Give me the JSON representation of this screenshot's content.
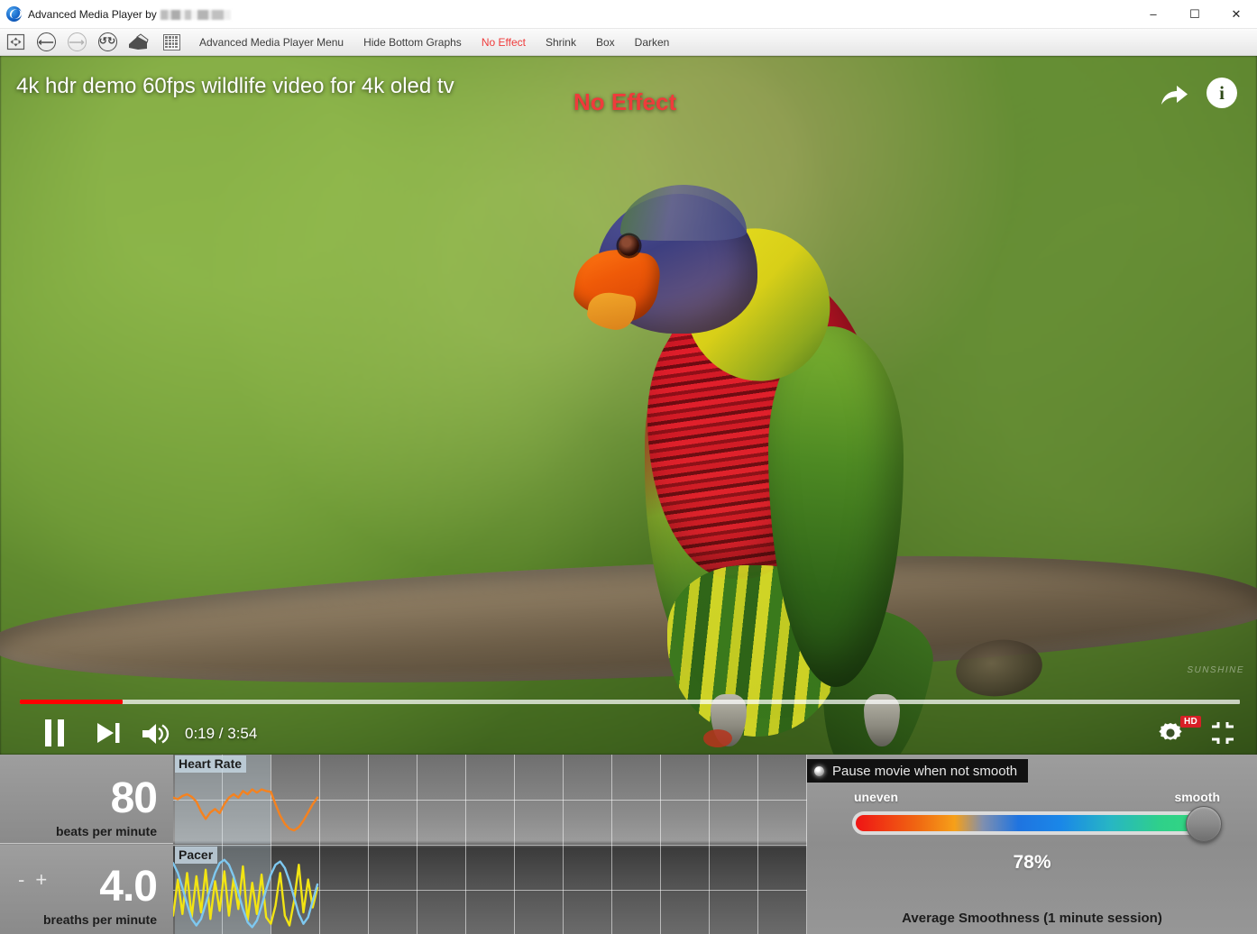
{
  "window": {
    "title": "Advanced Media Player by",
    "logo_icon": "app-logo-icon",
    "minimize": "–",
    "maximize": "☐",
    "close": "✕"
  },
  "toolbar": {
    "icons": [
      {
        "name": "resize-frame-icon",
        "glyph": "✥"
      },
      {
        "name": "back-arrow-icon",
        "glyph": "←"
      },
      {
        "name": "forward-arrow-icon",
        "glyph": "→"
      },
      {
        "name": "refresh-icon",
        "glyph": "↻"
      },
      {
        "name": "home-icon",
        "glyph": "⌂"
      },
      {
        "name": "menu-grid-icon",
        "glyph": "⊞"
      }
    ],
    "items": [
      {
        "label": "Advanced Media Player Menu",
        "accent": false
      },
      {
        "label": "Hide Bottom Graphs",
        "accent": false
      },
      {
        "label": "No Effect",
        "accent": true
      },
      {
        "label": "Shrink",
        "accent": false
      },
      {
        "label": "Box",
        "accent": false
      },
      {
        "label": "Darken",
        "accent": false
      }
    ]
  },
  "video": {
    "title": "4k hdr demo 60fps wildlife video for 4k oled tv",
    "effect_label": "No Effect",
    "effect_color": "#ef3b3b",
    "share_icon": "share-arrow-icon",
    "info_icon": "info-icon",
    "info_glyph": "i",
    "watermark": "SUNSHINE",
    "progress": {
      "percent": 8.4,
      "fill_color": "#ff0000"
    },
    "controls": {
      "pause_icon": "pause-icon",
      "next_icon": "next-track-icon",
      "volume_icon": "volume-icon",
      "time": "0:19 / 3:54",
      "settings_icon": "settings-gear-icon",
      "quality_badge": "HD",
      "fullscreen_icon": "exit-fullscreen-icon"
    }
  },
  "bottom": {
    "heart_rate": {
      "value": "80",
      "unit": "beats per minute",
      "graph_label": "Heart Rate"
    },
    "breathing": {
      "value": "4.0",
      "unit": "breaths per minute",
      "graph_label": "Pacer",
      "decrement": "-",
      "increment": "+"
    },
    "smoothness": {
      "toggle_label": "Pause movie when not smooth",
      "slider_min_label": "uneven",
      "slider_max_label": "smooth",
      "percent": "78%",
      "caption": "Average Smoothness (1 minute session)",
      "knob_position_percent": 100
    }
  },
  "chart_data": [
    {
      "type": "line",
      "title": "Heart Rate",
      "ylabel": "beats per minute",
      "series": [
        {
          "name": "heart-rate",
          "color": "#f5821f",
          "values": [
            52,
            50,
            54,
            56,
            53,
            47,
            35,
            26,
            34,
            38,
            33,
            44,
            52,
            56,
            52,
            60,
            56,
            62,
            58,
            62,
            60,
            59,
            44,
            30,
            20,
            14,
            12,
            16,
            24,
            34,
            44,
            52
          ]
        }
      ],
      "grid": true,
      "legend": "none"
    },
    {
      "type": "line",
      "title": "Pacer",
      "ylabel": "breaths per minute",
      "series": [
        {
          "name": "breathing-wave",
          "color": "#f2e413",
          "values": [
            18,
            62,
            20,
            70,
            16,
            66,
            22,
            74,
            14,
            60,
            24,
            72,
            18,
            64,
            26,
            78,
            12,
            58,
            20,
            68,
            16,
            8,
            30,
            70,
            18,
            6,
            36,
            80,
            22,
            62,
            28,
            52
          ]
        },
        {
          "name": "pacer-guide",
          "color": "#7ec8f0",
          "values": [
            82,
            70,
            52,
            32,
            14,
            6,
            14,
            32,
            52,
            70,
            82,
            86,
            80,
            66,
            46,
            26,
            10,
            4,
            12,
            30,
            50,
            68,
            80,
            84,
            76,
            60,
            40,
            20,
            8,
            16,
            36,
            56
          ]
        }
      ],
      "grid": true,
      "legend": "none"
    }
  ]
}
